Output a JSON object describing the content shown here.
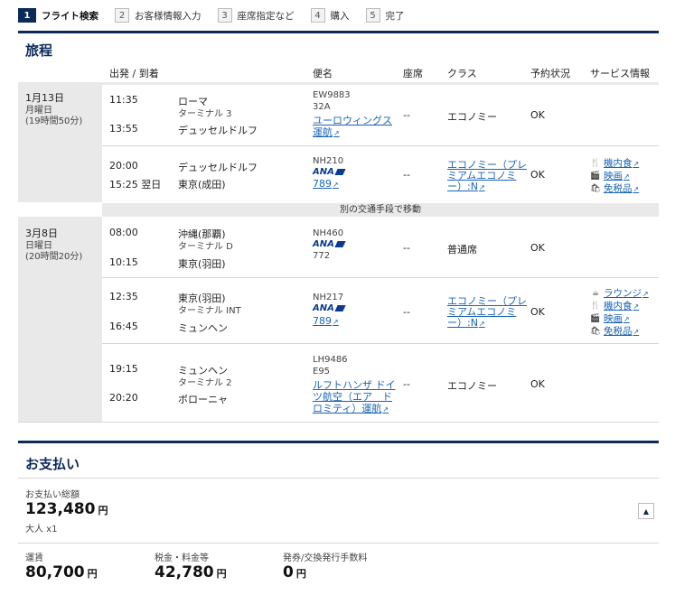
{
  "stepper": [
    {
      "num": "1",
      "label": "フライト検索"
    },
    {
      "num": "2",
      "label": "お客様情報入力"
    },
    {
      "num": "3",
      "label": "座席指定など"
    },
    {
      "num": "4",
      "label": "購入"
    },
    {
      "num": "5",
      "label": "完了"
    }
  ],
  "itinerary": {
    "title": "旅程",
    "columns": {
      "dep_arr": "出発 / 到着",
      "flight": "便名",
      "seat": "座席",
      "class": "クラス",
      "status": "予約状況",
      "service": "サービス情報"
    },
    "day1": {
      "date": "1月13日",
      "weekday": "月曜日",
      "duration": "(19時間50分)"
    },
    "day2": {
      "date": "3月8日",
      "weekday": "日曜日",
      "duration": "(20時間20分)"
    },
    "transfer": "別の交通手段で移動",
    "seg1": {
      "dep_time": "11:35",
      "dep_city": "ローマ",
      "dep_term": "ターミナル 3",
      "arr_time": "13:55",
      "arr_city": "デュッセルドルフ",
      "flight": "EW9883",
      "aircraft": "32A",
      "operator1": "ユーロウィングス",
      "operator2": "運航",
      "seat": "--",
      "class": "エコノミー",
      "status": "OK"
    },
    "seg2": {
      "dep_time": "20:00",
      "dep_city": "デュッセルドルフ",
      "arr_time": "15:25 翌日",
      "arr_city": "東京(成田)",
      "flight": "NH210",
      "airline_logo": "ANA",
      "aircraft": "789",
      "seat": "--",
      "class1": "エコノミー（プレ",
      "class2": "ミアムエコノミ",
      "class3": "ー）:N",
      "status": "OK",
      "svc_meal": "機内食",
      "svc_movie": "映画",
      "svc_dutyfree": "免税品"
    },
    "seg3": {
      "dep_time": "08:00",
      "dep_city": "沖縄(那覇)",
      "dep_term": "ターミナル D",
      "arr_time": "10:15",
      "arr_city": "東京(羽田)",
      "flight": "NH460",
      "airline_logo": "ANA",
      "aircraft": "772",
      "seat": "--",
      "class": "普通席",
      "status": "OK"
    },
    "seg4": {
      "dep_time": "12:35",
      "dep_city": "東京(羽田)",
      "dep_term": "ターミナル INT",
      "arr_time": "16:45",
      "arr_city": "ミュンヘン",
      "flight": "NH217",
      "airline_logo": "ANA",
      "aircraft": "789",
      "seat": "--",
      "class1": "エコノミー（プレ",
      "class2": "ミアムエコノミ",
      "class3": "ー）:N",
      "status": "OK",
      "svc_lounge": "ラウンジ",
      "svc_meal": "機内食",
      "svc_movie": "映画",
      "svc_dutyfree": "免税品"
    },
    "seg5": {
      "dep_time": "19:15",
      "dep_city": "ミュンヘン",
      "dep_term": "ターミナル 2",
      "arr_time": "20:20",
      "arr_city": "ボローニャ",
      "flight": "LH9486",
      "aircraft": "E95",
      "operator1": "ルフトハンザ ドイ",
      "operator2": "ツ航空（エア　ド",
      "operator3": "ロミティ）運航",
      "seat": "--",
      "class": "エコノミー",
      "status": "OK"
    }
  },
  "payment": {
    "title": "お支払い",
    "total_label": "お支払い総額",
    "total": "123,480",
    "yen": "円",
    "pax": "大人 x1",
    "fare_label": "運賃",
    "fare": "80,700",
    "tax_label": "税金・料金等",
    "tax": "42,780",
    "fee_label": "発券/交換発行手数料",
    "fee": "0"
  }
}
